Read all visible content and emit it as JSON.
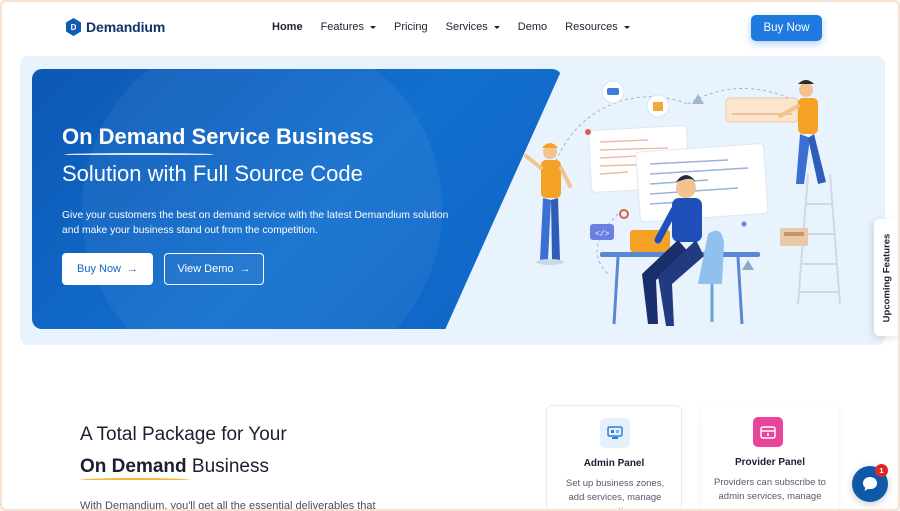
{
  "brand": {
    "name": "Demandium",
    "mark": "D"
  },
  "nav": {
    "items": [
      {
        "label": "Home",
        "active": true,
        "has_dropdown": false
      },
      {
        "label": "Features",
        "active": false,
        "has_dropdown": true
      },
      {
        "label": "Pricing",
        "active": false,
        "has_dropdown": false
      },
      {
        "label": "Services",
        "active": false,
        "has_dropdown": true
      },
      {
        "label": "Demo",
        "active": false,
        "has_dropdown": false
      },
      {
        "label": "Resources",
        "active": false,
        "has_dropdown": true
      }
    ],
    "cta": "Buy Now"
  },
  "hero": {
    "title_line1": "On Demand Service Business",
    "title_line2": "Solution with Full Source Code",
    "description": "Give your customers the best on demand service with the latest Demandium solution and make your business stand out from the competition.",
    "buy_label": "Buy Now",
    "demo_label": "View Demo",
    "arrow": "→"
  },
  "side_tab": "Upcoming Features",
  "package": {
    "line1": "A Total Package for Your",
    "line2_bold": "On Demand",
    "line2_rest": " Business",
    "desc": "With Demandium, you'll get all the essential deliverables that"
  },
  "cards": [
    {
      "title": "Admin Panel",
      "text": "Set up business zones, add services, manage promotions",
      "icon": "admin-panel-icon"
    },
    {
      "title": "Provider Panel",
      "text": "Providers can subscribe to admin services, manage",
      "icon": "provider-panel-icon"
    }
  ],
  "chat": {
    "badge": "1",
    "icon": "chat-bubble-icon"
  },
  "colors": {
    "primary": "#1f7ae0",
    "hero_blue": "#0c57b4",
    "accent_yellow": "#f2b63a",
    "provider_pink": "#e8449a"
  }
}
